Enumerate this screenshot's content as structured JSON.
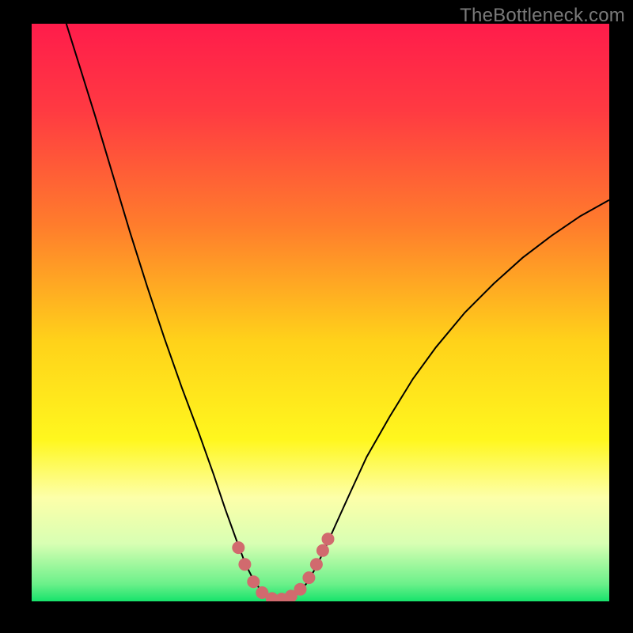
{
  "watermark": "TheBottleneck.com",
  "chart_data": {
    "type": "line",
    "title": "",
    "xlabel": "",
    "ylabel": "",
    "xlim": [
      0,
      100
    ],
    "ylim": [
      0,
      100
    ],
    "background_gradient": {
      "stops": [
        {
          "offset": 0.0,
          "color": "#ff1c4b"
        },
        {
          "offset": 0.15,
          "color": "#ff3a42"
        },
        {
          "offset": 0.35,
          "color": "#ff7d2c"
        },
        {
          "offset": 0.55,
          "color": "#ffd21a"
        },
        {
          "offset": 0.72,
          "color": "#fff71e"
        },
        {
          "offset": 0.82,
          "color": "#fdffa9"
        },
        {
          "offset": 0.9,
          "color": "#d8ffb3"
        },
        {
          "offset": 0.97,
          "color": "#6bf08a"
        },
        {
          "offset": 1.0,
          "color": "#17e36b"
        }
      ]
    },
    "series": [
      {
        "name": "bottleneck-curve",
        "stroke": "#000000",
        "stroke_width": 2,
        "points": [
          {
            "x": 6.0,
            "y": 100.0
          },
          {
            "x": 8.5,
            "y": 92.0
          },
          {
            "x": 11.0,
            "y": 84.0
          },
          {
            "x": 14.0,
            "y": 74.0
          },
          {
            "x": 17.0,
            "y": 64.0
          },
          {
            "x": 20.0,
            "y": 54.5
          },
          {
            "x": 23.0,
            "y": 45.5
          },
          {
            "x": 26.0,
            "y": 37.0
          },
          {
            "x": 29.0,
            "y": 29.0
          },
          {
            "x": 31.5,
            "y": 22.0
          },
          {
            "x": 33.5,
            "y": 16.0
          },
          {
            "x": 35.5,
            "y": 10.5
          },
          {
            "x": 37.0,
            "y": 6.5
          },
          {
            "x": 38.5,
            "y": 3.5
          },
          {
            "x": 40.0,
            "y": 1.5
          },
          {
            "x": 41.5,
            "y": 0.5
          },
          {
            "x": 43.0,
            "y": 0.2
          },
          {
            "x": 44.5,
            "y": 0.4
          },
          {
            "x": 46.0,
            "y": 1.3
          },
          {
            "x": 47.5,
            "y": 3.0
          },
          {
            "x": 49.0,
            "y": 5.5
          },
          {
            "x": 50.5,
            "y": 8.5
          },
          {
            "x": 52.5,
            "y": 13.0
          },
          {
            "x": 55.0,
            "y": 18.5
          },
          {
            "x": 58.0,
            "y": 25.0
          },
          {
            "x": 62.0,
            "y": 32.0
          },
          {
            "x": 66.0,
            "y": 38.5
          },
          {
            "x": 70.0,
            "y": 44.0
          },
          {
            "x": 75.0,
            "y": 50.0
          },
          {
            "x": 80.0,
            "y": 55.0
          },
          {
            "x": 85.0,
            "y": 59.5
          },
          {
            "x": 90.0,
            "y": 63.3
          },
          {
            "x": 95.0,
            "y": 66.7
          },
          {
            "x": 100.0,
            "y": 69.5
          }
        ]
      },
      {
        "name": "highlight-dots",
        "stroke": "#d16a6e",
        "marker_radius": 8,
        "points": [
          {
            "x": 35.8,
            "y": 9.3
          },
          {
            "x": 36.9,
            "y": 6.4
          },
          {
            "x": 38.4,
            "y": 3.4
          },
          {
            "x": 39.9,
            "y": 1.5
          },
          {
            "x": 41.6,
            "y": 0.5
          },
          {
            "x": 43.3,
            "y": 0.4
          },
          {
            "x": 44.9,
            "y": 0.9
          },
          {
            "x": 46.5,
            "y": 2.1
          },
          {
            "x": 48.0,
            "y": 4.1
          },
          {
            "x": 49.3,
            "y": 6.4
          },
          {
            "x": 50.4,
            "y": 8.8
          },
          {
            "x": 51.3,
            "y": 10.8
          }
        ]
      }
    ]
  }
}
